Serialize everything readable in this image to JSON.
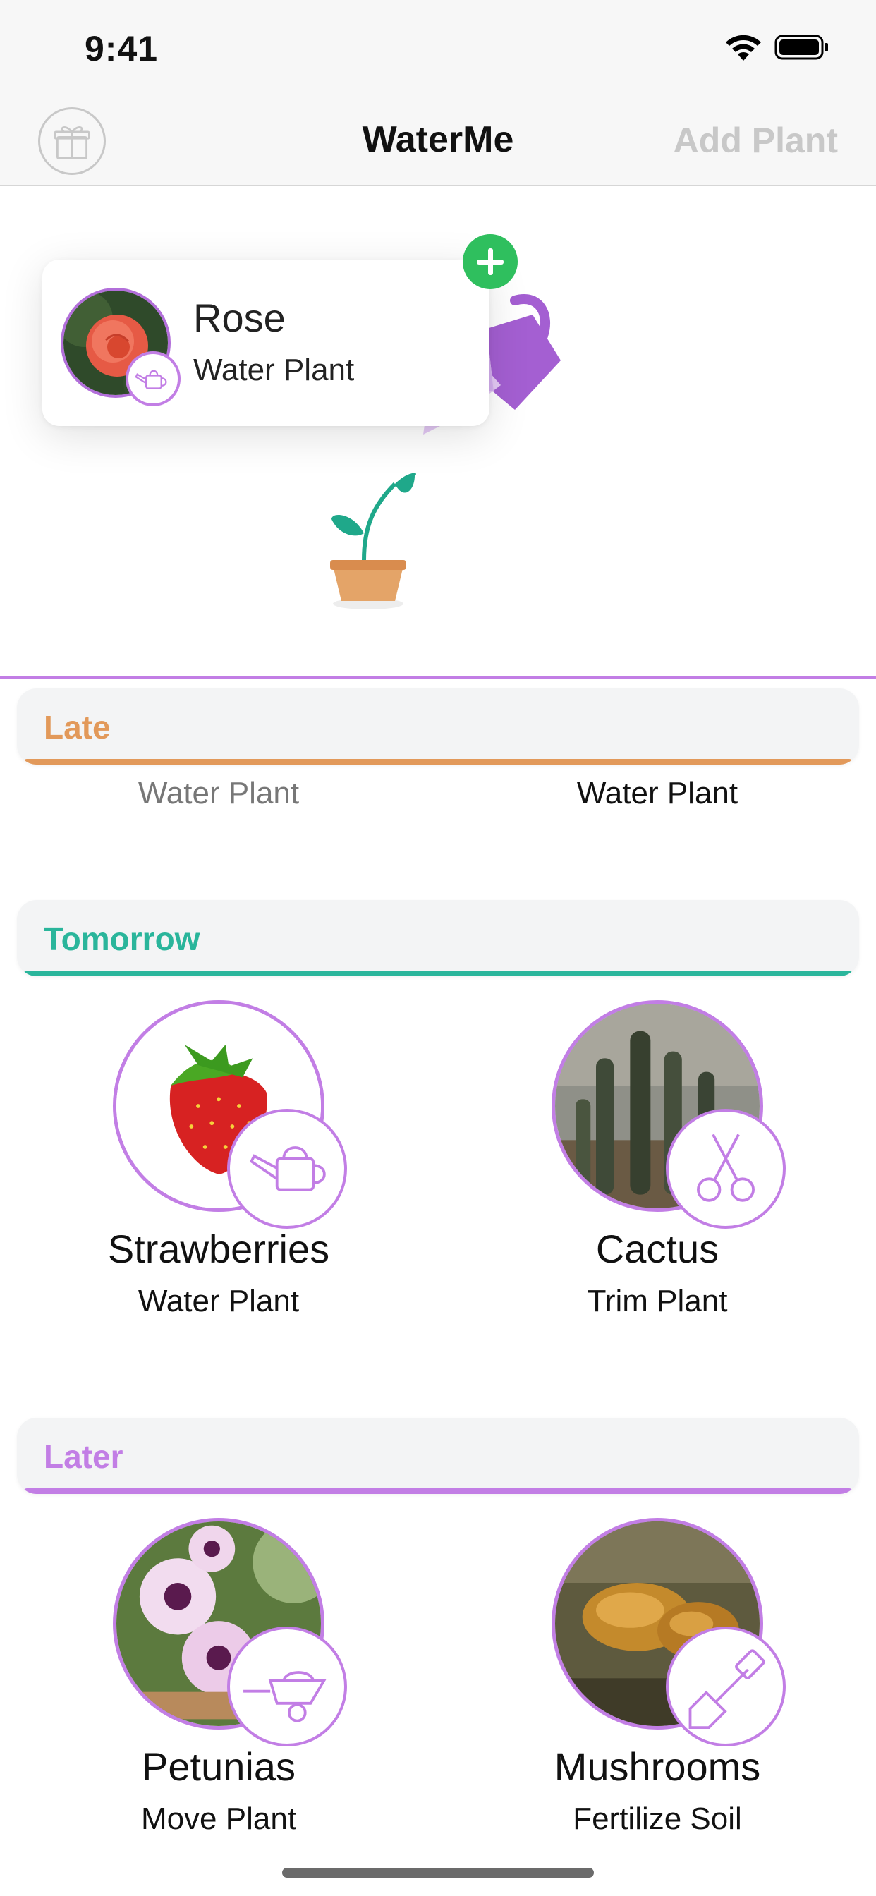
{
  "status_bar": {
    "time": "9:41"
  },
  "nav": {
    "title": "WaterMe",
    "add_plant": "Add Plant",
    "gift_icon": "gift-icon"
  },
  "onboarding": {
    "card": {
      "name": "Rose",
      "task": "Water Plant"
    },
    "plus_icon": "plus-icon",
    "watering_can_icon": "watering-can-icon",
    "sprout_icon": "sprout-icon"
  },
  "sections": {
    "late": {
      "label": "Late",
      "color": "#e2995a",
      "tasks": [
        "Water Plant",
        "Water Plant"
      ]
    },
    "tomorrow": {
      "label": "Tomorrow",
      "color": "#2ab59b",
      "plants": [
        {
          "name": "Strawberries",
          "task": "Water Plant",
          "badge_icon": "watering-can-icon"
        },
        {
          "name": "Cactus",
          "task": "Trim Plant",
          "badge_icon": "scissors-icon"
        }
      ]
    },
    "later": {
      "label": "Later",
      "color": "#c27ee5",
      "plants": [
        {
          "name": "Petunias",
          "task": "Move Plant",
          "badge_icon": "wheelbarrow-icon"
        },
        {
          "name": "Mushrooms",
          "task": "Fertilize Soil",
          "badge_icon": "shovel-icon"
        }
      ]
    }
  },
  "colors": {
    "accent": "#c27ee5",
    "add_button": "#2fbf5e",
    "nav_disabled": "#c8c8c8"
  }
}
